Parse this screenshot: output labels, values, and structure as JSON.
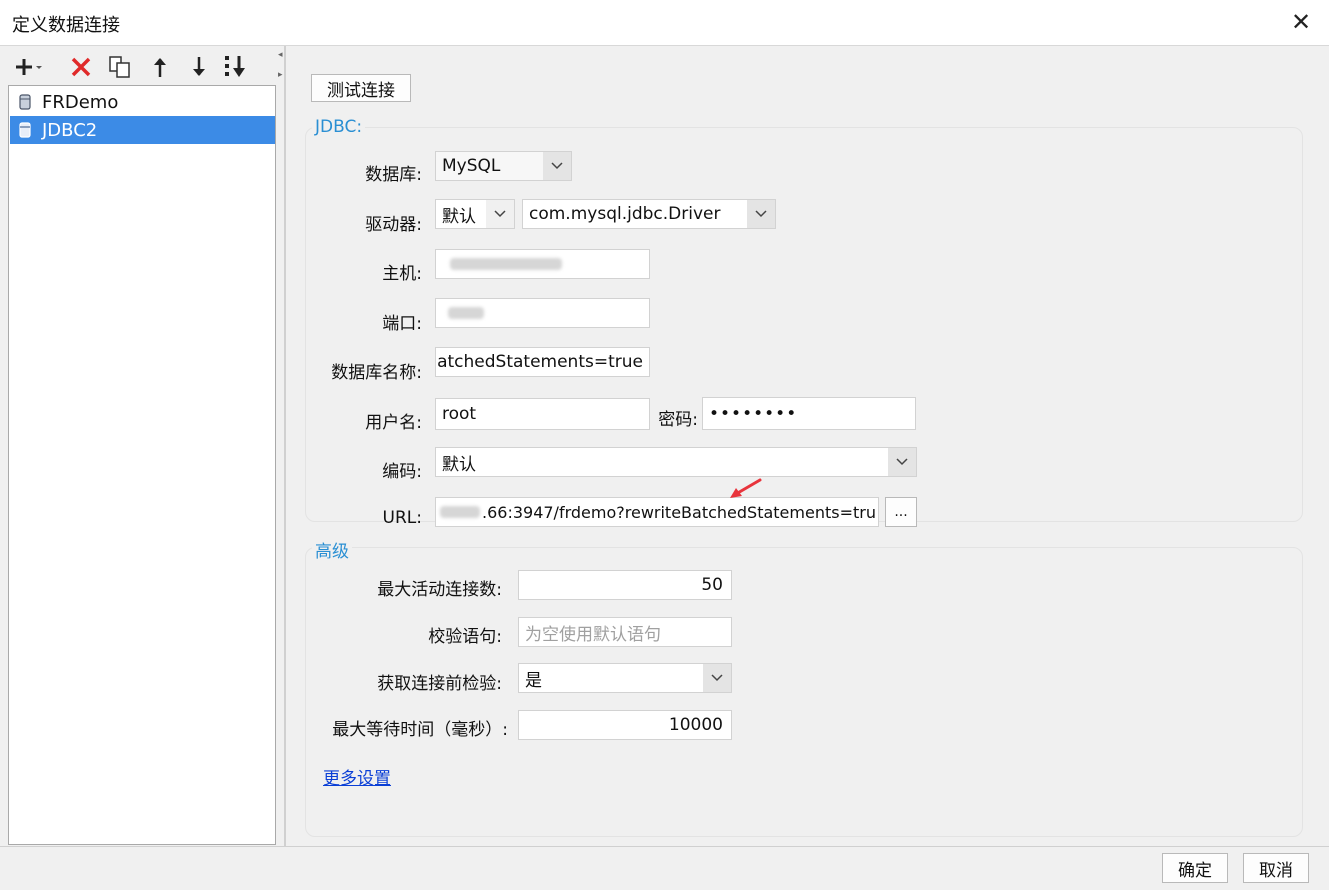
{
  "window": {
    "title": "定义数据连接"
  },
  "toolbar": {
    "icons": [
      "add-dropdown-icon",
      "delete-icon",
      "copy-icon",
      "move-up-icon",
      "move-down-icon",
      "sort-icon"
    ]
  },
  "connections": [
    {
      "label": "FRDemo",
      "selected": false
    },
    {
      "label": "JDBC2",
      "selected": true
    }
  ],
  "test_button": "测试连接",
  "jdbc": {
    "group_title": "JDBC:",
    "database_label": "数据库:",
    "database_value": "MySQL",
    "driver_label": "驱动器:",
    "driver_mode": "默认",
    "driver_class": "com.mysql.jdbc.Driver",
    "host_label": "主机:",
    "port_label": "端口:",
    "dbname_label": "数据库名称:",
    "dbname_value": "eBatchedStatements=true",
    "username_label": "用户名:",
    "username_value": "root",
    "password_label": "密码:",
    "password_value": "••••••••",
    "encoding_label": "编码:",
    "encoding_value": "默认",
    "url_label": "URL:",
    "url_value": ".66:3947/frdemo?rewriteBatchedStatements=tru",
    "url_button": "..."
  },
  "advanced": {
    "group_title": "高级",
    "max_active_label": "最大活动连接数:",
    "max_active_value": "50",
    "validation_label": "校验语句:",
    "validation_placeholder": "为空使用默认语句",
    "test_before_label": "获取连接前检验:",
    "test_before_value": "是",
    "max_wait_label": "最大等待时间（毫秒）:",
    "max_wait_value": "10000",
    "more_settings": "更多设置"
  },
  "footer": {
    "ok": "确定",
    "cancel": "取消"
  },
  "colors": {
    "selection": "#3c8be6",
    "group_title": "#2a8fd3",
    "link": "#0b3fd6",
    "annotation_arrow": "#e8343c"
  }
}
